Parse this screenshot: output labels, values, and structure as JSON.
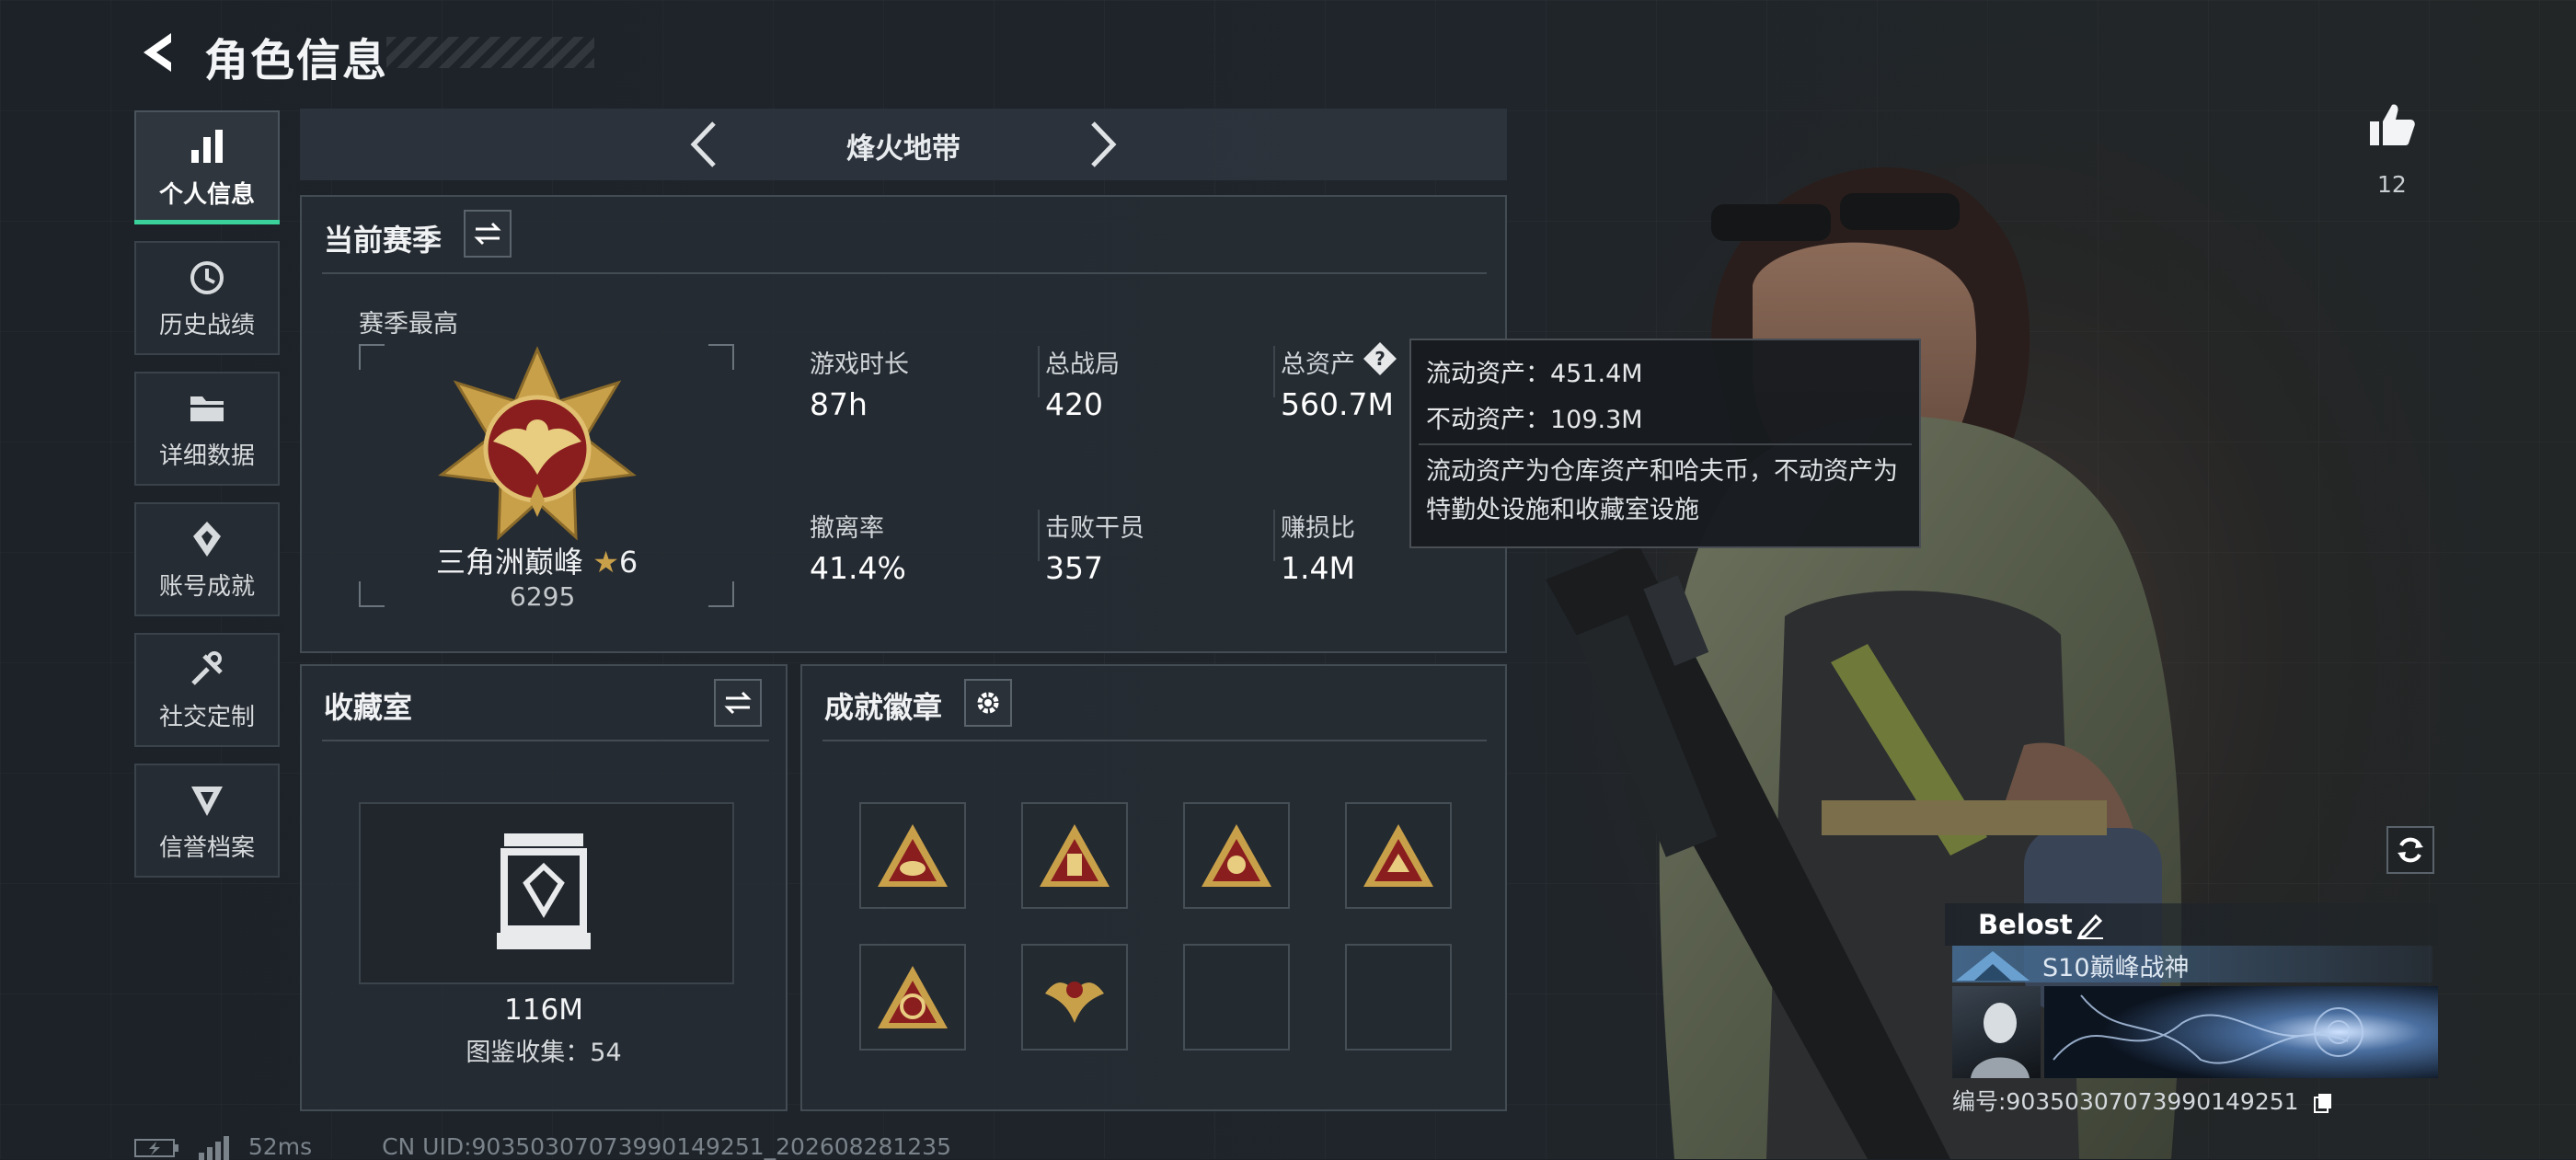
{
  "header": {
    "title": "角色信息"
  },
  "sidebar": {
    "items": [
      {
        "label": "个人信息",
        "icon": "bar-chart-icon",
        "active": true
      },
      {
        "label": "历史战绩",
        "icon": "history-clock-icon",
        "active": false
      },
      {
        "label": "详细数据",
        "icon": "folder-icon",
        "active": false
      },
      {
        "label": "账号成就",
        "icon": "achievement-badge-icon",
        "active": false
      },
      {
        "label": "社交定制",
        "icon": "wrench-icon",
        "active": false
      },
      {
        "label": "信誉档案",
        "icon": "credit-shield-icon",
        "active": false
      }
    ]
  },
  "mode": {
    "label": "烽火地带"
  },
  "season": {
    "title": "当前赛季",
    "best_label": "赛季最高",
    "rank_name": "三角洲巅峰",
    "rank_stars": "6",
    "rank_score": "6295",
    "stats": [
      {
        "label": "游戏时长",
        "value": "87h"
      },
      {
        "label": "总战局",
        "value": "420"
      },
      {
        "label": "总资产",
        "value": "560.7M"
      },
      {
        "label": "撤离率",
        "value": "41.4%"
      },
      {
        "label": "击败干员",
        "value": "357"
      },
      {
        "label": "赚损比",
        "value": "1.4M"
      }
    ]
  },
  "tooltip": {
    "liquid": "流动资产：451.4M",
    "fixed": "不动资产：109.3M",
    "desc": "流动资产为仓库资产和哈夫币，不动资产为特勤处设施和收藏室设施"
  },
  "collection": {
    "title": "收藏室",
    "value": "116M",
    "count_text": "图鉴收集：54"
  },
  "achievements": {
    "title": "成就徽章",
    "badges": [
      "badge-1",
      "badge-2",
      "badge-3",
      "badge-4",
      "badge-s8",
      "badge-s9",
      "",
      ""
    ]
  },
  "profile": {
    "likes": "12",
    "name": "Belost",
    "title": "S10巅峰战神",
    "id_text": "编号:90350307073990149251"
  },
  "status": {
    "ping": "52ms",
    "uid": "CN UID:90350307073990149251_202608281235"
  },
  "colors": {
    "accent": "#3ad19a",
    "gold": "#c9a04a",
    "badge_red": "#8a1e1e"
  }
}
